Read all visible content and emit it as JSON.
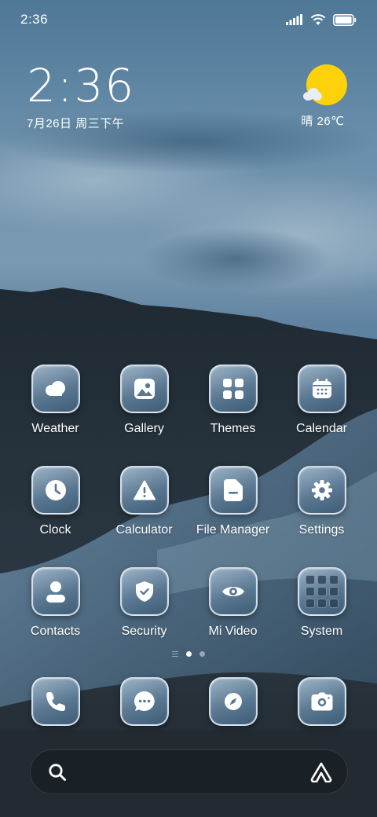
{
  "status_bar": {
    "time": "2:36",
    "icons": [
      "signal-icon",
      "wifi-icon",
      "battery-icon"
    ]
  },
  "clock_widget": {
    "time": "2:36",
    "date": "7月26日 周三下午"
  },
  "weather_widget": {
    "icon": "sunny-cloud-icon",
    "condition_temp": "晴 26℃"
  },
  "apps": [
    {
      "label": "Weather",
      "icon": "weather-cloud-icon"
    },
    {
      "label": "Gallery",
      "icon": "gallery-icon"
    },
    {
      "label": "Themes",
      "icon": "themes-grid-icon"
    },
    {
      "label": "Calendar",
      "icon": "calendar-icon"
    },
    {
      "label": "Clock",
      "icon": "clock-icon"
    },
    {
      "label": "Calculator",
      "icon": "warning-triangle-icon"
    },
    {
      "label": "File Manager",
      "icon": "folder-icon"
    },
    {
      "label": "Settings",
      "icon": "gear-icon"
    },
    {
      "label": "Contacts",
      "icon": "person-icon"
    },
    {
      "label": "Security",
      "icon": "shield-check-icon"
    },
    {
      "label": "Mi Video",
      "icon": "eye-icon"
    },
    {
      "label": "System",
      "icon": "folder-grid-icon"
    }
  ],
  "page_indicator": {
    "pages": 2,
    "active_page": 1
  },
  "dock": [
    {
      "icon": "phone-icon"
    },
    {
      "icon": "message-icon"
    },
    {
      "icon": "compass-icon"
    },
    {
      "icon": "camera-icon"
    }
  ],
  "search_bar": {
    "left_icon": "search-icon",
    "right_icon": "assistant-a-icon"
  },
  "colors": {
    "icon_face_top": "#9cb3c6",
    "icon_face_bottom": "#3f5c75",
    "sun": "#fdd20a",
    "text": "#ffffff"
  }
}
